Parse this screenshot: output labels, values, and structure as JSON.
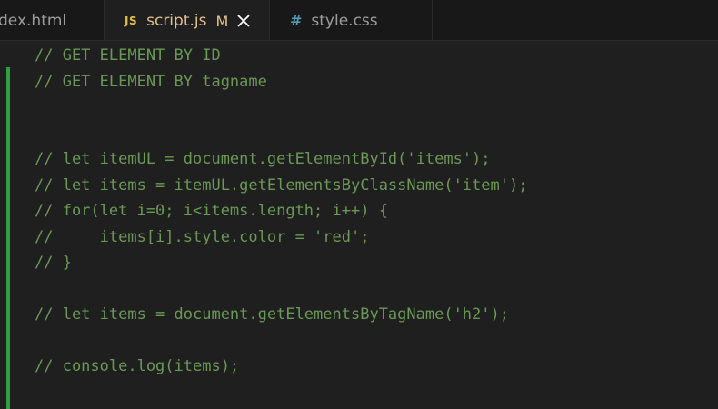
{
  "tabs": [
    {
      "label": "dex.html",
      "icon": "html-file-icon",
      "active": false
    },
    {
      "label": "script.js",
      "icon": "js-file-icon",
      "icon_text": "JS",
      "modified_badge": "M",
      "active": true
    },
    {
      "label": "style.css",
      "icon": "css-file-icon",
      "icon_text": "#",
      "active": false
    }
  ],
  "editor": {
    "lines": [
      "// GET ELEMENT BY ID",
      "// GET ELEMENT BY tagname",
      "// let itemUL = document.getElementById('items');",
      "// let items = itemUL.getElementsByClassName('item');",
      "// for(let i=0; i<items.length; i++) {",
      "//     items[i].style.color = 'red';",
      "// }",
      "// let items = document.getElementsByTagName('h2');",
      "// console.log(items);"
    ]
  },
  "colors": {
    "comment": "#6a9955",
    "editor_background": "#1f1f1f",
    "tabbar_background": "#181818",
    "git_added": "#2ea043",
    "js_icon": "#e2c04a",
    "css_icon": "#519aba",
    "modified": "#e2c08d"
  }
}
